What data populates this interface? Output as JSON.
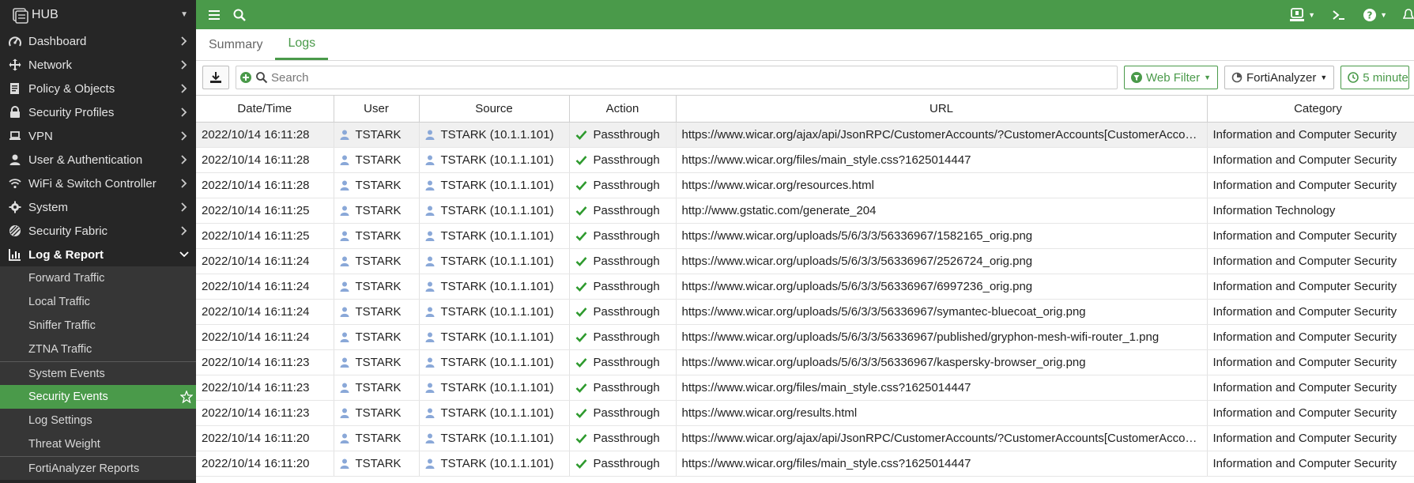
{
  "sidebar": {
    "device": "HUB",
    "items": [
      {
        "label": "Dashboard",
        "icon": "dashboard-icon"
      },
      {
        "label": "Network",
        "icon": "network-icon"
      },
      {
        "label": "Policy & Objects",
        "icon": "policy-icon"
      },
      {
        "label": "Security Profiles",
        "icon": "lock-icon"
      },
      {
        "label": "VPN",
        "icon": "laptop-icon"
      },
      {
        "label": "User & Authentication",
        "icon": "user-icon"
      },
      {
        "label": "WiFi & Switch Controller",
        "icon": "wifi-icon"
      },
      {
        "label": "System",
        "icon": "gear-icon"
      },
      {
        "label": "Security Fabric",
        "icon": "fabric-icon"
      },
      {
        "label": "Log & Report",
        "icon": "chart-icon"
      }
    ],
    "sub_items": [
      {
        "label": "Forward Traffic"
      },
      {
        "label": "Local Traffic"
      },
      {
        "label": "Sniffer Traffic"
      },
      {
        "label": "ZTNA Traffic"
      },
      {
        "label": "System Events"
      },
      {
        "label": "Security Events"
      },
      {
        "label": "Log Settings"
      },
      {
        "label": "Threat Weight"
      },
      {
        "label": "FortiAnalyzer Reports"
      }
    ]
  },
  "tabs": [
    {
      "label": "Summary"
    },
    {
      "label": "Logs"
    }
  ],
  "toolbar": {
    "search_placeholder": "Search",
    "web_filter": "Web Filter",
    "source": "FortiAnalyzer",
    "time_range": "5 minute"
  },
  "colors": {
    "accent": "#4a9a4a",
    "sidebar_bg": "#262626",
    "passthrough_check": "#2e9a2e"
  },
  "table": {
    "columns": [
      "Date/Time",
      "User",
      "Source",
      "Action",
      "URL",
      "Category"
    ],
    "rows": [
      {
        "datetime": "2022/10/14 16:11:28",
        "user": "TSTARK",
        "source": "TSTARK (10.1.1.101)",
        "action": "Passthrough",
        "url": "https://www.wicar.org/ajax/api/JsonRPC/CustomerAccounts/?CustomerAccounts[CustomerAccou…",
        "category": "Information and Computer Security"
      },
      {
        "datetime": "2022/10/14 16:11:28",
        "user": "TSTARK",
        "source": "TSTARK (10.1.1.101)",
        "action": "Passthrough",
        "url": "https://www.wicar.org/files/main_style.css?1625014447",
        "category": "Information and Computer Security"
      },
      {
        "datetime": "2022/10/14 16:11:28",
        "user": "TSTARK",
        "source": "TSTARK (10.1.1.101)",
        "action": "Passthrough",
        "url": "https://www.wicar.org/resources.html",
        "category": "Information and Computer Security"
      },
      {
        "datetime": "2022/10/14 16:11:25",
        "user": "TSTARK",
        "source": "TSTARK (10.1.1.101)",
        "action": "Passthrough",
        "url": "http://www.gstatic.com/generate_204",
        "category": "Information Technology"
      },
      {
        "datetime": "2022/10/14 16:11:25",
        "user": "TSTARK",
        "source": "TSTARK (10.1.1.101)",
        "action": "Passthrough",
        "url": "https://www.wicar.org/uploads/5/6/3/3/56336967/1582165_orig.png",
        "category": "Information and Computer Security"
      },
      {
        "datetime": "2022/10/14 16:11:24",
        "user": "TSTARK",
        "source": "TSTARK (10.1.1.101)",
        "action": "Passthrough",
        "url": "https://www.wicar.org/uploads/5/6/3/3/56336967/2526724_orig.png",
        "category": "Information and Computer Security"
      },
      {
        "datetime": "2022/10/14 16:11:24",
        "user": "TSTARK",
        "source": "TSTARK (10.1.1.101)",
        "action": "Passthrough",
        "url": "https://www.wicar.org/uploads/5/6/3/3/56336967/6997236_orig.png",
        "category": "Information and Computer Security"
      },
      {
        "datetime": "2022/10/14 16:11:24",
        "user": "TSTARK",
        "source": "TSTARK (10.1.1.101)",
        "action": "Passthrough",
        "url": "https://www.wicar.org/uploads/5/6/3/3/56336967/symantec-bluecoat_orig.png",
        "category": "Information and Computer Security"
      },
      {
        "datetime": "2022/10/14 16:11:24",
        "user": "TSTARK",
        "source": "TSTARK (10.1.1.101)",
        "action": "Passthrough",
        "url": "https://www.wicar.org/uploads/5/6/3/3/56336967/published/gryphon-mesh-wifi-router_1.png",
        "category": "Information and Computer Security"
      },
      {
        "datetime": "2022/10/14 16:11:23",
        "user": "TSTARK",
        "source": "TSTARK (10.1.1.101)",
        "action": "Passthrough",
        "url": "https://www.wicar.org/uploads/5/6/3/3/56336967/kaspersky-browser_orig.png",
        "category": "Information and Computer Security"
      },
      {
        "datetime": "2022/10/14 16:11:23",
        "user": "TSTARK",
        "source": "TSTARK (10.1.1.101)",
        "action": "Passthrough",
        "url": "https://www.wicar.org/files/main_style.css?1625014447",
        "category": "Information and Computer Security"
      },
      {
        "datetime": "2022/10/14 16:11:23",
        "user": "TSTARK",
        "source": "TSTARK (10.1.1.101)",
        "action": "Passthrough",
        "url": "https://www.wicar.org/results.html",
        "category": "Information and Computer Security"
      },
      {
        "datetime": "2022/10/14 16:11:20",
        "user": "TSTARK",
        "source": "TSTARK (10.1.1.101)",
        "action": "Passthrough",
        "url": "https://www.wicar.org/ajax/api/JsonRPC/CustomerAccounts/?CustomerAccounts[CustomerAccou…",
        "category": "Information and Computer Security"
      },
      {
        "datetime": "2022/10/14 16:11:20",
        "user": "TSTARK",
        "source": "TSTARK (10.1.1.101)",
        "action": "Passthrough",
        "url": "https://www.wicar.org/files/main_style.css?1625014447",
        "category": "Information and Computer Security"
      }
    ]
  }
}
